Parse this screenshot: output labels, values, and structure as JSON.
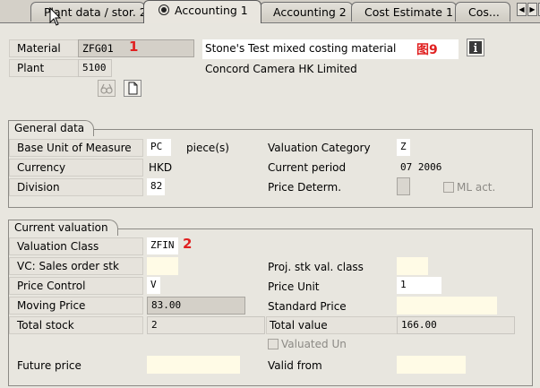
{
  "tabs": [
    {
      "label": "Plant data / stor. 2",
      "active": false
    },
    {
      "label": "Accounting 1",
      "active": true
    },
    {
      "label": "Accounting 2",
      "active": false
    },
    {
      "label": "Cost Estimate 1",
      "active": false
    },
    {
      "label": "Cos...",
      "active": false
    }
  ],
  "header": {
    "material_label": "Material",
    "material_value": "ZFG01",
    "material_description": "Stone's Test mixed costing material",
    "plant_label": "Plant",
    "plant_value": "5100",
    "plant_description": "Concord Camera HK Limited"
  },
  "annotations": {
    "tag1": "1",
    "tag2": "2",
    "figure": "图9"
  },
  "general_data": {
    "title": "General data",
    "base_uom_label": "Base Unit of Measure",
    "base_uom_value": "PC",
    "base_uom_text": "piece(s)",
    "valuation_category_label": "Valuation Category",
    "valuation_category_value": "Z",
    "currency_label": "Currency",
    "currency_value": "HKD",
    "current_period_label": "Current period",
    "current_period_value": "07 2006",
    "division_label": "Division",
    "division_value": "82",
    "price_determ_label": "Price Determ.",
    "ml_act_label": "ML act."
  },
  "current_valuation": {
    "title": "Current valuation",
    "valuation_class_label": "Valuation Class",
    "valuation_class_value": "ZFIN",
    "vc_sales_order_label": "VC: Sales order stk",
    "proj_stk_label": "Proj. stk val. class",
    "price_control_label": "Price Control",
    "price_control_value": "V",
    "price_unit_label": "Price Unit",
    "price_unit_value": "1",
    "moving_price_label": "Moving Price",
    "moving_price_value": "83.00",
    "standard_price_label": "Standard Price",
    "total_stock_label": "Total stock",
    "total_stock_value": "2",
    "total_value_label": "Total value",
    "total_value_value": "166.00",
    "valuated_un_label": "Valuated Un",
    "future_price_label": "Future price",
    "valid_from_label": "Valid from"
  },
  "icons": [
    "cursor-arrow-icon",
    "accounting-tab-icon",
    "info-icon",
    "glasses-icon",
    "document-icon",
    "tab-scroll-left-icon",
    "tab-scroll-right-icon",
    "tab-menu-icon"
  ]
}
